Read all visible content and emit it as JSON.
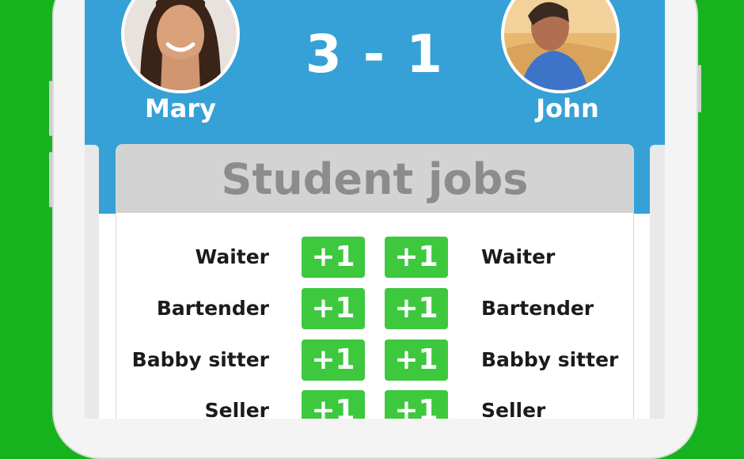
{
  "colors": {
    "background": "#17b31f",
    "scorebar": "#35a1d6",
    "plus_button": "#3ec83e",
    "card_header": "#d3d3d3",
    "card_title": "#8c8c8c"
  },
  "players": {
    "left": {
      "name": "Mary"
    },
    "right": {
      "name": "John"
    }
  },
  "score": "3 - 1",
  "card": {
    "title": "Student jobs",
    "plus_label": "+1",
    "rows": [
      {
        "left": "Waiter",
        "right": "Waiter"
      },
      {
        "left": "Bartender",
        "right": "Bartender"
      },
      {
        "left": "Babby sitter",
        "right": "Babby sitter"
      },
      {
        "left": "Seller",
        "right": "Seller"
      }
    ]
  }
}
